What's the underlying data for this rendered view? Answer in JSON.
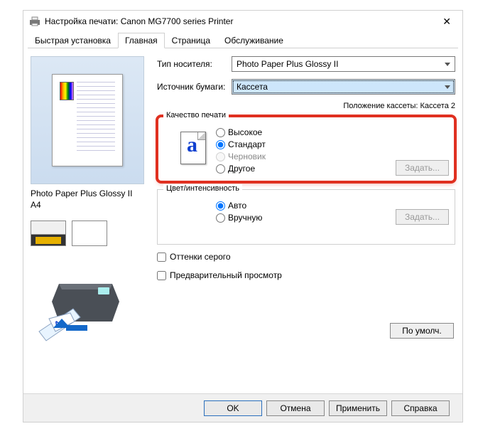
{
  "window": {
    "title": "Настройка печати: Canon MG7700 series Printer"
  },
  "tabs": {
    "t0": "Быстрая установка",
    "t1": "Главная",
    "t2": "Страница",
    "t3": "Обслуживание"
  },
  "left": {
    "paper_line1": "Photo Paper Plus Glossy II",
    "paper_line2": "A4"
  },
  "fields": {
    "media_label": "Тип носителя:",
    "media_value": "Photo Paper Plus Glossy II",
    "source_label": "Источник бумаги:",
    "source_value": "Кассета",
    "cassette_pos": "Положение кассеты: Кассета 2"
  },
  "quality": {
    "title": "Качество печати",
    "high": "Высокое",
    "standard": "Стандарт",
    "draft": "Черновик",
    "other": "Другое",
    "set_btn": "Задать..."
  },
  "color": {
    "title": "Цвет/интенсивность",
    "auto": "Авто",
    "manual": "Вручную",
    "set_btn": "Задать..."
  },
  "checks": {
    "gray": "Оттенки серого",
    "preview": "Предварительный просмотр"
  },
  "buttons": {
    "defaults": "По умолч.",
    "ok": "OK",
    "cancel": "Отмена",
    "apply": "Применить",
    "help": "Справка"
  }
}
